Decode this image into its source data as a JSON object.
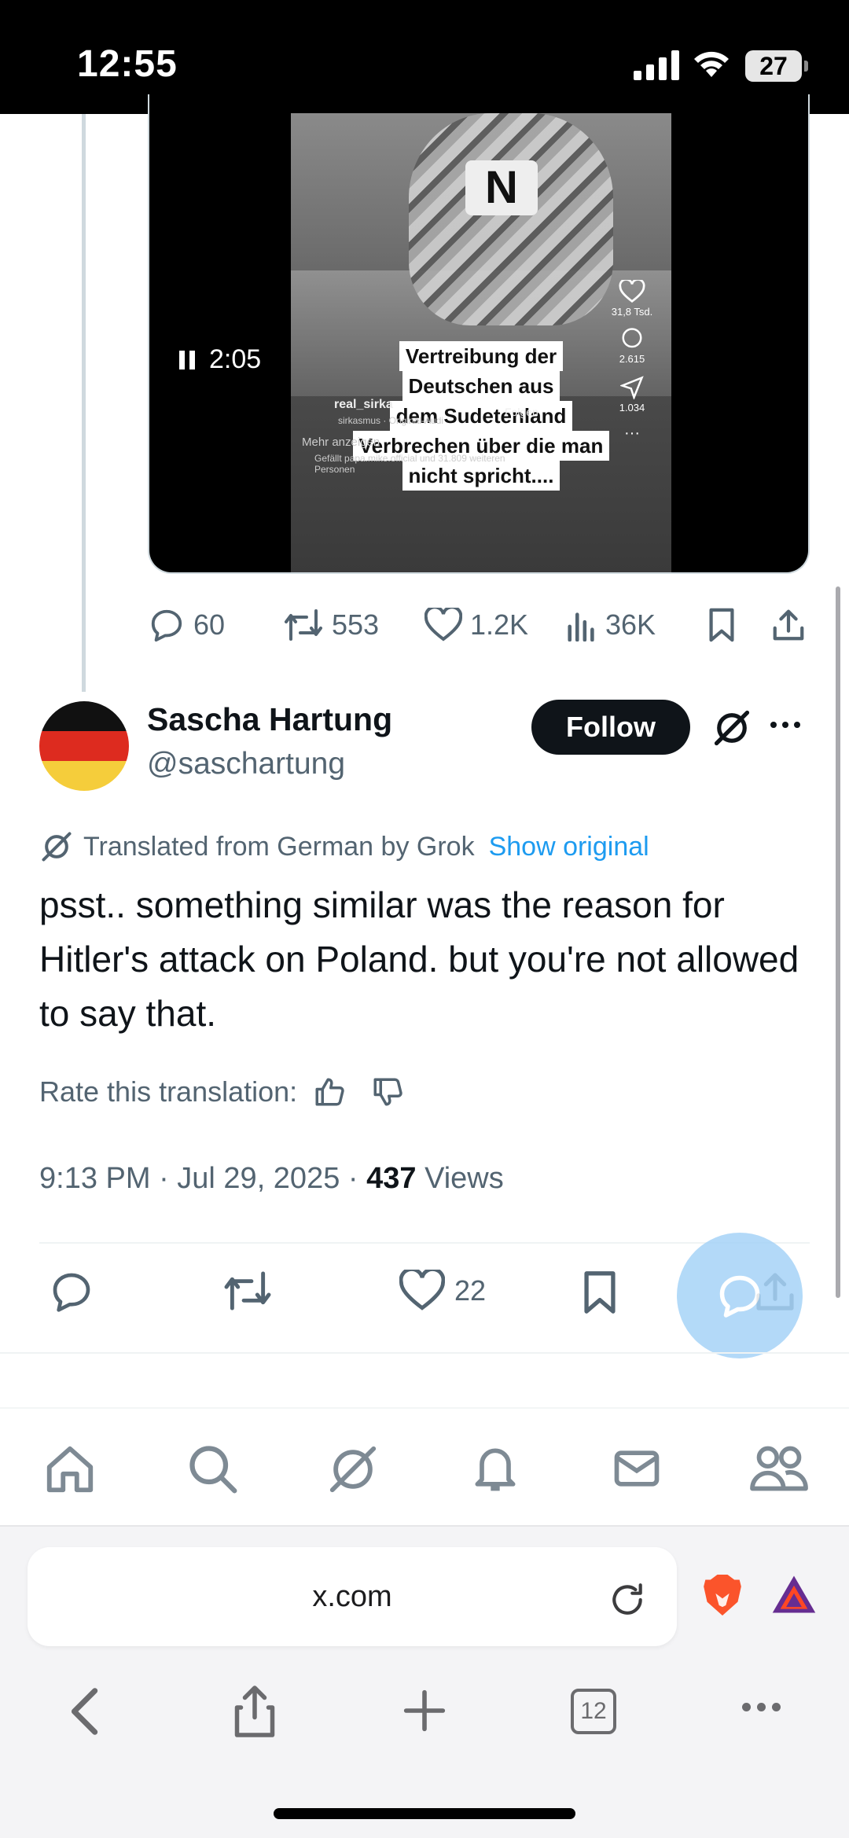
{
  "status_bar": {
    "time": "12:55",
    "battery": "27"
  },
  "quoted_video": {
    "duration": "2:05",
    "overlay_lines": [
      "Vertreibung der",
      "Deutschen aus",
      "dem Sudetenland",
      "Verbrechen über die man",
      "nicht spricht...."
    ],
    "like_count": "31,8 Tsd.",
    "comment_count": "2.615",
    "share_count": "1.034",
    "creator": "real_sirka",
    "audio": "sirkasmus · Original-Audi",
    "follow_label": "Folgen",
    "more_label": "Mehr anzeigen",
    "liked_by": "Gefällt papa.mike.official und 31.809 weiteren Personen"
  },
  "quoted_actions": {
    "replies": "60",
    "reposts": "553",
    "likes": "1.2K",
    "views": "36K"
  },
  "author": {
    "name": "Sascha Hartung",
    "handle": "@saschartung",
    "follow_label": "Follow"
  },
  "translation": {
    "notice": "Translated from German by Grok",
    "show_original": "Show original",
    "rate_label": "Rate this translation:"
  },
  "tweet": {
    "text": "psst.. something similar was the reason for Hitler's attack on Poland. but you're not allowed to say that.",
    "time": "9:13 PM · Jul 29, 2025 · ",
    "views_count": "437",
    "views_label": " Views",
    "likes": "22"
  },
  "browser": {
    "url": "x.com",
    "tab_count": "12"
  }
}
